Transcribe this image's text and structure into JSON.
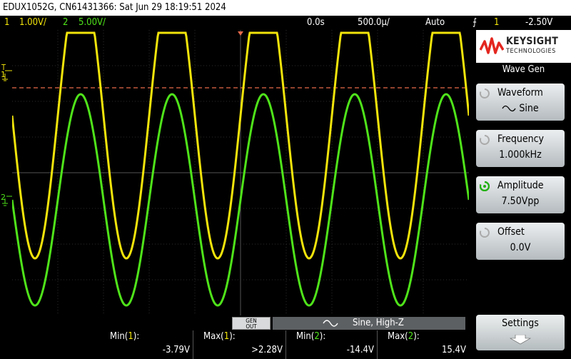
{
  "header": {
    "title": "EDUX1052G, CN61431366: Sat Jun 29 18:19:51 2024"
  },
  "status": {
    "ch1_num": "1",
    "ch1_scale": "1.00V/",
    "ch2_num": "2",
    "ch2_scale": "5.00V/",
    "time_delay": "0.0s",
    "time_scale": "500.0µ/",
    "trigger_mode": "Auto",
    "trigger_source": "1",
    "trigger_level": "-2.50V"
  },
  "markers": {
    "ch1_marker": "1",
    "ch2_marker": "2",
    "trigger_marker": "T"
  },
  "brand": {
    "name": "KEYSIGHT",
    "sub": "TECHNOLOGIES"
  },
  "menu": {
    "title": "Wave Gen",
    "waveform_label": "Waveform",
    "waveform_value": "Sine",
    "frequency_label": "Frequency",
    "frequency_value": "1.000kHz",
    "amplitude_label": "Amplitude",
    "amplitude_value": "7.50Vpp",
    "offset_label": "Offset",
    "offset_value": "0.0V",
    "settings_label": "Settings"
  },
  "gen_out": {
    "line1": "GEN",
    "line2": "OUT",
    "info": "Sine, High-Z"
  },
  "measurements": [
    {
      "label": "Min(1):",
      "value": "-3.79V"
    },
    {
      "label": "Max(1):",
      "value": ">2.28V"
    },
    {
      "label": "Min(2):",
      "value": "-14.4V"
    },
    {
      "label": "Max(2):",
      "value": "15.4V"
    }
  ],
  "colors": {
    "ch1": "#f2e40b",
    "ch2": "#4fe31a",
    "trigger_line": "#e8694a",
    "grid": "#2c2c2c"
  },
  "traces": {
    "frequency_hz": 1000,
    "periods_on_screen": 5
  }
}
